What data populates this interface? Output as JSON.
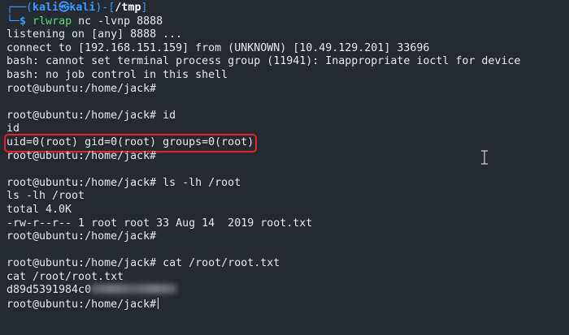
{
  "prompt": {
    "corner_top": "┌──(",
    "user": "kali",
    "at": "㉿",
    "host": "kali",
    "sep": ")-[",
    "path": "/tmp",
    "close": "]",
    "corner_bottom": "└─",
    "dollar": "$",
    "command": "rlwrap",
    "args": "nc -lvnp 8888"
  },
  "lines": {
    "l1": "listening on [any] 8888 ...",
    "l2": "connect to [192.168.151.159] from (UNKNOWN) [10.49.129.201] 33696",
    "l3": "bash: cannot set terminal process group (11941): Inappropriate ioctl for device",
    "l4": "bash: no job control in this shell",
    "l5": "root@ubuntu:/home/jack#",
    "l6": "",
    "l7": "root@ubuntu:/home/jack# id",
    "l8": "id",
    "l9_highlight": "uid=0(root) gid=0(root) groups=0(root)",
    "l10": "root@ubuntu:/home/jack#",
    "l11": "",
    "l12": "root@ubuntu:/home/jack# ls -lh /root",
    "l13": "ls -lh /root",
    "l14": "total 4.0K",
    "l15": "-rw-r--r-- 1 root root 33 Aug 14  2019 root.txt",
    "l16": "root@ubuntu:/home/jack#",
    "l17": "",
    "l18": "root@ubuntu:/home/jack# cat /root/root.txt",
    "l19": "cat /root/root.txt",
    "l20_visible": "d89d5391984c0",
    "l21": "root@ubuntu:/home/jack#"
  }
}
